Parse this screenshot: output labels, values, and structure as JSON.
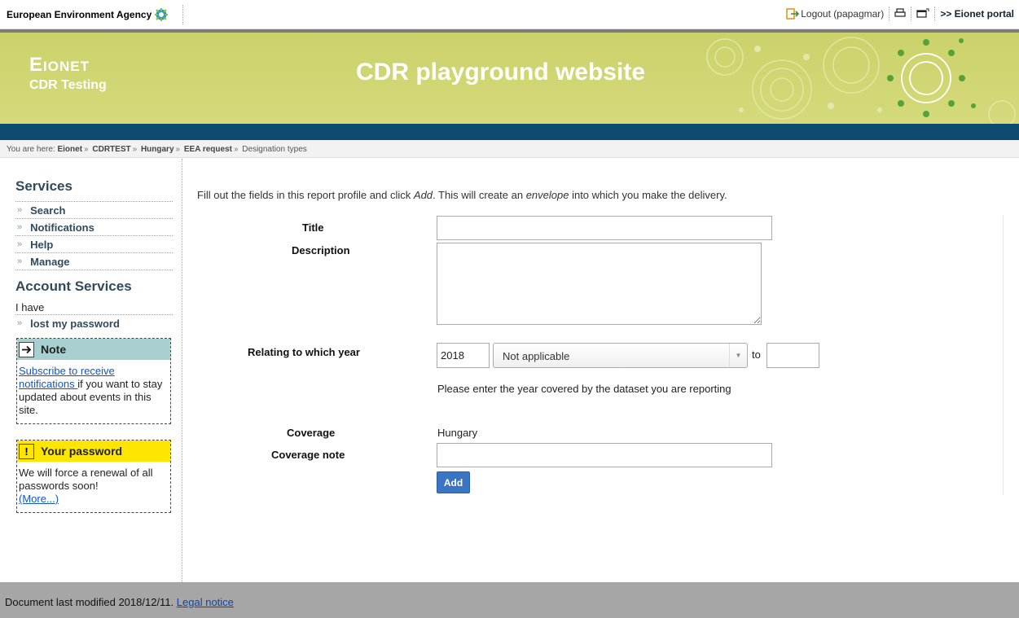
{
  "topbar": {
    "agency": "European Environment Agency",
    "logout": "Logout (papagmar)",
    "portal": ">> Eionet portal"
  },
  "banner": {
    "brand": "Eionet",
    "subbrand": "CDR Testing",
    "title": "CDR playground website"
  },
  "breadcrumb": {
    "prefix": "You are here:",
    "items": [
      "Eionet",
      "CDRTEST",
      "Hungary",
      "EEA request",
      "Designation types"
    ],
    "separator": "»"
  },
  "sidebar": {
    "services_title": "Services",
    "services": [
      "Search",
      "Notifications",
      "Help",
      "Manage"
    ],
    "account_title": "Account Services",
    "i_have": "I have",
    "lost_password": "lost my password",
    "note": {
      "title": "Note",
      "link": "Subscribe to receive notifications ",
      "text": "if you want to stay updated about events in this site."
    },
    "password": {
      "title": "Your password",
      "text": "We will force a renewal of all passwords soon!",
      "more": "(More...)"
    }
  },
  "form": {
    "intro_1": "Fill out the fields in this report profile and click ",
    "intro_add": "Add",
    "intro_2": ". This will create an ",
    "intro_envelope": "envelope",
    "intro_3": " into which you make the delivery.",
    "title_label": "Title",
    "title_value": "",
    "description_label": "Description",
    "description_value": "",
    "year_label": "Relating to which year",
    "year_from": "2018",
    "year_period": "Not applicable",
    "year_to_label": "to",
    "year_to": "",
    "year_hint": "Please enter the year covered by the dataset you are reporting",
    "coverage_label": "Coverage",
    "coverage_value": "Hungary",
    "coverage_note_label": "Coverage note",
    "coverage_note_value": "",
    "add_button": "Add"
  },
  "footer": {
    "text": "Document last modified 2018/12/11.",
    "legal": "Legal notice"
  },
  "colors": {
    "banner": "#cfd66f",
    "bluebar": "#0c4a6e",
    "note_head": "#a8d0d0",
    "password_head": "#ffe600",
    "button": "#3a75c4",
    "footer": "#a6a6a6"
  }
}
